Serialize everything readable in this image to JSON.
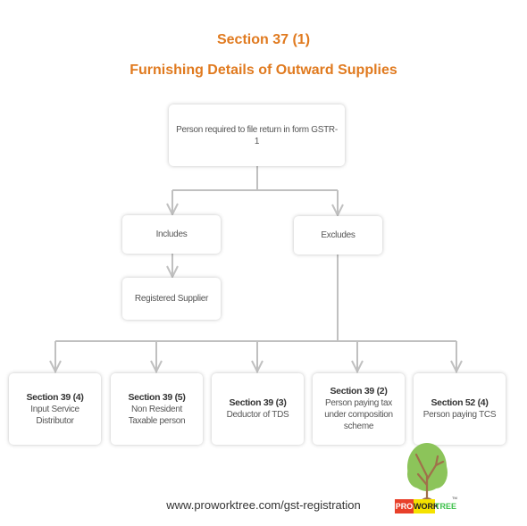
{
  "title": {
    "line1": "Section 37 (1)",
    "line2": "Furnishing Details of Outward Supplies"
  },
  "root": {
    "label": "Person required to file return in form GSTR-1"
  },
  "includes": {
    "label": "Includes",
    "child": "Registered Supplier"
  },
  "excludes": {
    "label": "Excludes",
    "items": [
      {
        "section": "Section 39 (4)",
        "desc": "Input Service Distributor"
      },
      {
        "section": "Section 39 (5)",
        "desc": "Non Resident Taxable person"
      },
      {
        "section": "Section 39 (3)",
        "desc": "Deductor of TDS"
      },
      {
        "section": "Section 39 (2)",
        "desc": "Person paying tax under composition scheme"
      },
      {
        "section": "Section 52 (4)",
        "desc": "Person paying TCS"
      }
    ]
  },
  "footer": {
    "url": "www.proworktree.com/gst-registration"
  },
  "logo": {
    "pro": "PRO",
    "work": "WORK",
    "tree": "TREE",
    "tm": "TM",
    "colors": {
      "pro_bg": "#e8402a",
      "work_bg": "#f5e200",
      "tree_text": "#3cc04a",
      "foliage": "#8cc45a",
      "trunk": "#a0704a"
    }
  },
  "colors": {
    "title": "#e07a1f",
    "connector": "#c0c0c0"
  }
}
